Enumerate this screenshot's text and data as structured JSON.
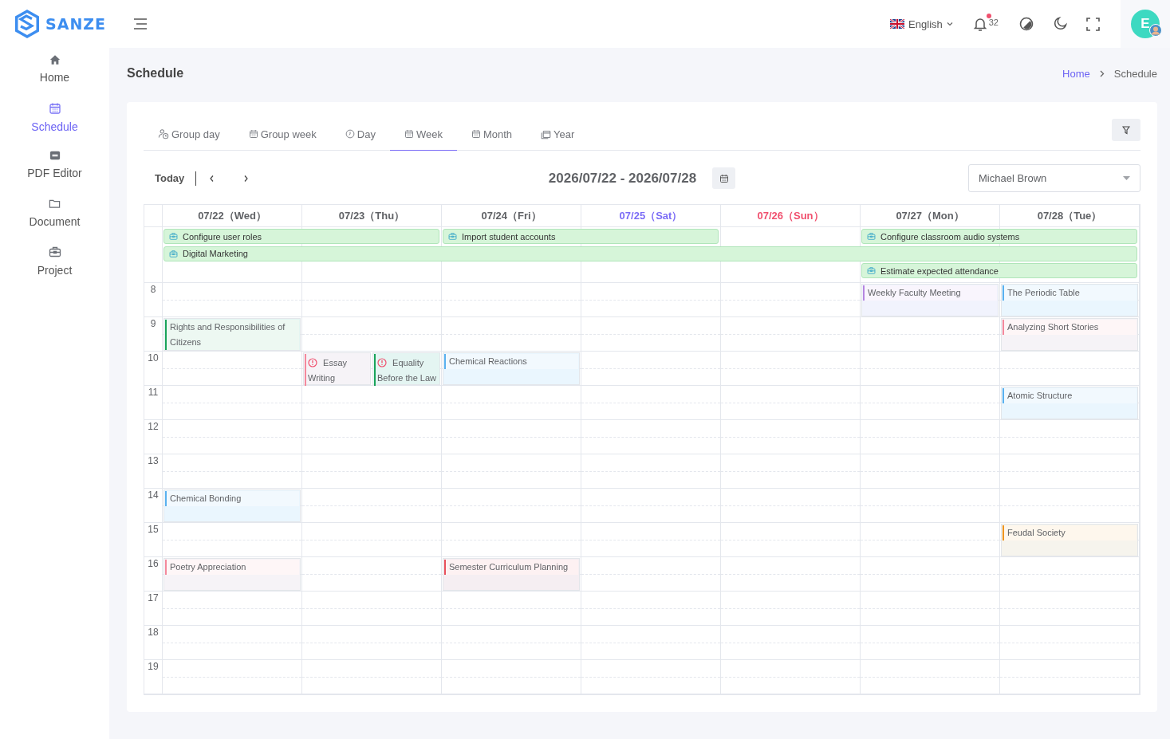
{
  "brand": {
    "name": "SANZE"
  },
  "sidebar": {
    "items": [
      {
        "label": "Home",
        "selected": false
      },
      {
        "label": "Schedule",
        "selected": true
      },
      {
        "label": "PDF Editor",
        "selected": false
      },
      {
        "label": "Document",
        "selected": false
      },
      {
        "label": "Project",
        "selected": false
      }
    ]
  },
  "topbar": {
    "language": "English",
    "notifications": {
      "count": "32",
      "unread": true
    },
    "avatar": {
      "initial": "E"
    }
  },
  "page": {
    "title": "Schedule",
    "breadcrumb": [
      {
        "label": "Home",
        "kind": "link"
      },
      {
        "label": "Schedule",
        "kind": "current"
      }
    ]
  },
  "calendar": {
    "tabs": [
      {
        "label": "Group day",
        "selected": false
      },
      {
        "label": "Group week",
        "selected": false
      },
      {
        "label": "Day",
        "selected": false
      },
      {
        "label": "Week",
        "selected": true
      },
      {
        "label": "Month",
        "selected": false
      },
      {
        "label": "Year",
        "selected": false
      }
    ],
    "toolbar": {
      "today": "Today",
      "range": "2026/07/22 - 2026/07/28",
      "person": "Michael Brown"
    },
    "days": [
      {
        "label": "07/22（Wed）",
        "kind": "weekday"
      },
      {
        "label": "07/23（Thu）",
        "kind": "weekday"
      },
      {
        "label": "07/24（Fri）",
        "kind": "weekday"
      },
      {
        "label": "07/25（Sat）",
        "kind": "saturday"
      },
      {
        "label": "07/26（Sun）",
        "kind": "sunday"
      },
      {
        "label": "07/27（Mon）",
        "kind": "weekday"
      },
      {
        "label": "07/28（Tue）",
        "kind": "weekday"
      }
    ],
    "all_day_rows": [
      {
        "cells": [
          {
            "kind": "bar",
            "title": "Configure user roles"
          },
          {
            "kind": "continued"
          },
          {
            "kind": "bar",
            "title": "Import student accounts"
          },
          {
            "kind": "continued"
          },
          {
            "kind": "empty"
          },
          {
            "kind": "bar",
            "title": "Configure classroom audio systems"
          },
          {
            "kind": "continued"
          }
        ]
      },
      {
        "cells": [
          {
            "kind": "bar",
            "title": "Digital Marketing"
          },
          {
            "kind": "continued"
          },
          {
            "kind": "continued"
          },
          {
            "kind": "continued"
          },
          {
            "kind": "continued"
          },
          {
            "kind": "continued"
          },
          {
            "kind": "continued"
          }
        ]
      },
      {
        "cells": [
          {
            "kind": "empty"
          },
          {
            "kind": "empty"
          },
          {
            "kind": "empty"
          },
          {
            "kind": "empty"
          },
          {
            "kind": "empty"
          },
          {
            "kind": "bar",
            "title": "Estimate expected attendance"
          },
          {
            "kind": "continued"
          }
        ]
      }
    ],
    "hour_rows": [
      {
        "hour": "8",
        "cells": [
          {},
          {},
          {},
          {},
          {},
          {
            "events": [
              {
                "title": "Weekly Faculty Meeting",
                "kind": "plain",
                "color": "#b586e0"
              }
            ]
          },
          {
            "events": [
              {
                "title": "The Periodic Table",
                "kind": "plain",
                "color": "#5ab1ef"
              }
            ]
          }
        ]
      },
      {
        "hour": "9",
        "cells": [
          {
            "events": [
              {
                "title": "Rights and Responsibilities of Citizens",
                "kind": "plain",
                "color": "#1aa35a"
              }
            ]
          },
          {},
          {},
          {},
          {},
          {},
          {
            "events": [
              {
                "title": "Analyzing Short Stories",
                "kind": "plain",
                "color": "#f4899c"
              }
            ]
          }
        ]
      },
      {
        "hour": "10",
        "cells": [
          {},
          {
            "events": [
              {
                "title": "Essay Writing",
                "kind": "alert",
                "color": "#f4899c"
              },
              {
                "title": "Equality Before the Law",
                "kind": "alert",
                "color": "#1aa35a"
              }
            ]
          },
          {
            "events": [
              {
                "title": "Chemical Reactions",
                "kind": "plain",
                "color": "#5ab1ef"
              }
            ]
          },
          {},
          {},
          {},
          {}
        ]
      },
      {
        "hour": "11",
        "cells": [
          {},
          {},
          {},
          {},
          {},
          {},
          {
            "events": [
              {
                "title": "Atomic Structure",
                "kind": "plain",
                "color": "#5ab1ef"
              }
            ]
          }
        ]
      },
      {
        "hour": "12",
        "cells": [
          {},
          {},
          {},
          {},
          {},
          {},
          {}
        ]
      },
      {
        "hour": "13",
        "cells": [
          {},
          {},
          {},
          {},
          {},
          {},
          {}
        ]
      },
      {
        "hour": "14",
        "cells": [
          {
            "events": [
              {
                "title": "Chemical Bonding",
                "kind": "plain",
                "color": "#5ab1ef"
              }
            ]
          },
          {},
          {},
          {},
          {},
          {},
          {}
        ]
      },
      {
        "hour": "15",
        "cells": [
          {},
          {},
          {},
          {},
          {},
          {},
          {
            "events": [
              {
                "title": "Feudal Society",
                "kind": "plain",
                "color": "#f0951f"
              }
            ]
          }
        ]
      },
      {
        "hour": "16",
        "cells": [
          {
            "events": [
              {
                "title": "Poetry Appreciation",
                "kind": "plain",
                "color": "#f4899c"
              }
            ]
          },
          {},
          {
            "events": [
              {
                "title": "Semester Curriculum Planning",
                "kind": "plain",
                "color": "#e8505b"
              }
            ]
          },
          {},
          {},
          {},
          {}
        ]
      },
      {
        "hour": "17",
        "cells": [
          {},
          {},
          {},
          {},
          {},
          {},
          {}
        ]
      },
      {
        "hour": "18",
        "cells": [
          {},
          {},
          {},
          {},
          {},
          {},
          {}
        ]
      },
      {
        "hour": "19",
        "cells": [
          {},
          {},
          {},
          {},
          {},
          {},
          {}
        ]
      }
    ]
  }
}
